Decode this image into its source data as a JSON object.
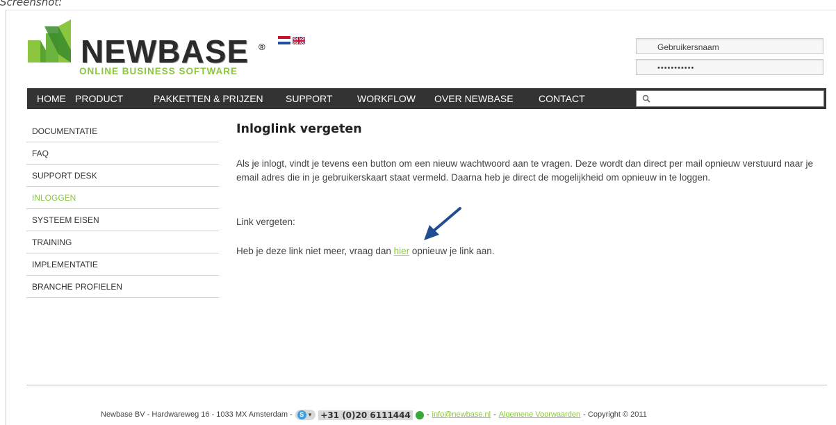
{
  "caption": "Screenshot:",
  "brand": {
    "name": "NEWBASE",
    "registered": "®",
    "tagline": "ONLINE BUSINESS SOFTWARE",
    "green": "#8cc63f",
    "dark_green": "#3a8b2a"
  },
  "languages": [
    {
      "name": "nl-flag-icon"
    },
    {
      "name": "uk-flag-icon"
    }
  ],
  "login": {
    "username_value": "Gebruikersnaam",
    "password_value": "•••••••••••"
  },
  "nav": {
    "items": [
      {
        "label": "HOME"
      },
      {
        "label": "PRODUCT"
      },
      {
        "label": "PAKKETTEN & PRIJZEN"
      },
      {
        "label": "SUPPORT"
      },
      {
        "label": "WORKFLOW"
      },
      {
        "label": "OVER NEWBASE"
      },
      {
        "label": "CONTACT"
      }
    ],
    "search_icon": "search-icon",
    "bar_color": "#333333"
  },
  "sidebar": {
    "items": [
      {
        "label": "DOCUMENTATIE"
      },
      {
        "label": "FAQ"
      },
      {
        "label": "SUPPORT DESK"
      },
      {
        "label": "INLOGGEN",
        "active": true
      },
      {
        "label": "SYSTEEM EISEN"
      },
      {
        "label": "TRAINING"
      },
      {
        "label": "IMPLEMENTATIE"
      },
      {
        "label": "BRANCHE PROFIELEN"
      }
    ]
  },
  "main": {
    "title": "Inloglink vergeten",
    "paragraph1": "Als je inlogt, vindt je tevens een button om een nieuw wachtwoord aan te vragen. Deze wordt dan direct per mail opnieuw verstuurd naar je email adres die in je gebruikerskaart staat vermeld. Daarna heb je direct de mogelijkheid om opnieuw in te loggen.",
    "paragraph2": "Link vergeten:",
    "paragraph3_before": "Heb je deze link niet meer, vraag dan ",
    "paragraph3_link": "hier",
    "paragraph3_after": " opnieuw je link aan."
  },
  "footer": {
    "address": "Newbase BV -  Hardwareweg 16 - 1033 MX Amsterdam -",
    "phone": "+31 (0)20 6111444",
    "sep1": "-",
    "email": "info@newbase.nl",
    "sep2": "-",
    "terms": "Algemene Voorwaarden",
    "copyright": "- Copyright © 2011"
  }
}
